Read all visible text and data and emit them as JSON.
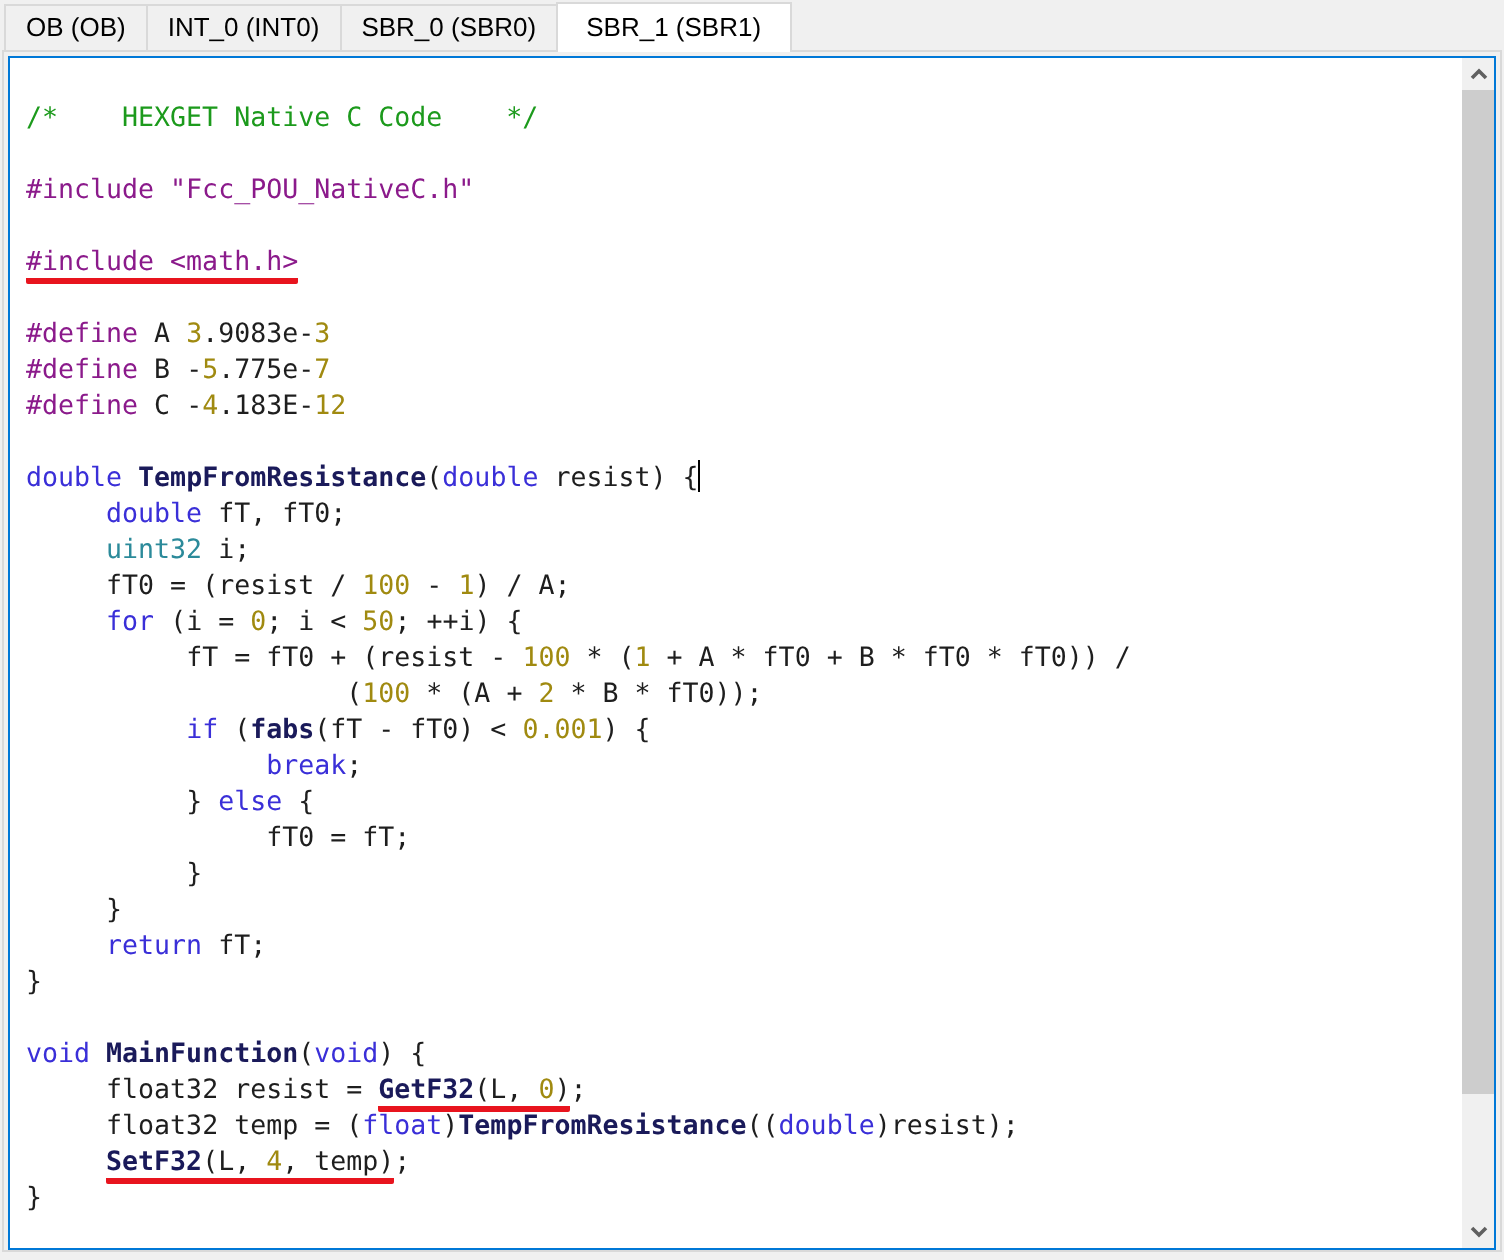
{
  "tabs": [
    {
      "label": "OB (OB)",
      "selected": false
    },
    {
      "label": "INT_0 (INT0)",
      "selected": false
    },
    {
      "label": "SBR_0 (SBR0)",
      "selected": false
    },
    {
      "label": "SBR_1 (SBR1)",
      "selected": true
    }
  ],
  "editor": {
    "lines": [
      {
        "kind": "blank"
      },
      {
        "kind": "code",
        "groups": [
          {
            "underlined": false,
            "tokens": [
              {
                "kind": "comment",
                "text": "/*    HEXGET Native C Code    */"
              }
            ]
          }
        ]
      },
      {
        "kind": "blank"
      },
      {
        "kind": "code",
        "groups": [
          {
            "underlined": false,
            "tokens": [
              {
                "kind": "directive",
                "text": "#include \"Fcc_POU_NativeC.h\""
              }
            ]
          }
        ]
      },
      {
        "kind": "blank"
      },
      {
        "kind": "code",
        "groups": [
          {
            "underlined": true,
            "tokens": [
              {
                "kind": "directive",
                "text": "#include <math.h>"
              }
            ]
          }
        ]
      },
      {
        "kind": "blank"
      },
      {
        "kind": "code",
        "groups": [
          {
            "underlined": false,
            "tokens": [
              {
                "kind": "directive",
                "text": "#define"
              },
              {
                "kind": "plain",
                "text": " A "
              },
              {
                "kind": "number",
                "text": "3"
              },
              {
                "kind": "plain",
                "text": ".9083e-"
              },
              {
                "kind": "number",
                "text": "3"
              }
            ]
          }
        ]
      },
      {
        "kind": "code",
        "groups": [
          {
            "underlined": false,
            "tokens": [
              {
                "kind": "directive",
                "text": "#define"
              },
              {
                "kind": "plain",
                "text": " B -"
              },
              {
                "kind": "number",
                "text": "5"
              },
              {
                "kind": "plain",
                "text": ".775e-"
              },
              {
                "kind": "number",
                "text": "7"
              }
            ]
          }
        ]
      },
      {
        "kind": "code",
        "groups": [
          {
            "underlined": false,
            "tokens": [
              {
                "kind": "directive",
                "text": "#define"
              },
              {
                "kind": "plain",
                "text": " C -"
              },
              {
                "kind": "number",
                "text": "4"
              },
              {
                "kind": "plain",
                "text": ".183E-"
              },
              {
                "kind": "number",
                "text": "12"
              }
            ]
          }
        ]
      },
      {
        "kind": "blank"
      },
      {
        "kind": "code",
        "groups": [
          {
            "underlined": false,
            "tokens": [
              {
                "kind": "keyword",
                "text": "double "
              },
              {
                "kind": "function",
                "text": "TempFromResistance"
              },
              {
                "kind": "plain",
                "text": "("
              },
              {
                "kind": "keyword",
                "text": "double"
              },
              {
                "kind": "plain",
                "text": " resist) {"
              },
              {
                "kind": "cursor"
              }
            ]
          }
        ]
      },
      {
        "kind": "code",
        "groups": [
          {
            "underlined": false,
            "tokens": [
              {
                "kind": "keyword",
                "text": "     double"
              },
              {
                "kind": "plain",
                "text": " fT, fT0;"
              }
            ]
          }
        ]
      },
      {
        "kind": "code",
        "groups": [
          {
            "underlined": false,
            "tokens": [
              {
                "kind": "type",
                "text": "     uint32"
              },
              {
                "kind": "plain",
                "text": " i;"
              }
            ]
          }
        ]
      },
      {
        "kind": "code",
        "groups": [
          {
            "underlined": false,
            "tokens": [
              {
                "kind": "plain",
                "text": "     fT0 = (resist / "
              },
              {
                "kind": "number",
                "text": "100"
              },
              {
                "kind": "plain",
                "text": " - "
              },
              {
                "kind": "number",
                "text": "1"
              },
              {
                "kind": "plain",
                "text": ") / A;"
              }
            ]
          }
        ]
      },
      {
        "kind": "code",
        "groups": [
          {
            "underlined": false,
            "tokens": [
              {
                "kind": "keyword",
                "text": "     for"
              },
              {
                "kind": "plain",
                "text": " (i = "
              },
              {
                "kind": "number",
                "text": "0"
              },
              {
                "kind": "plain",
                "text": "; i < "
              },
              {
                "kind": "number",
                "text": "50"
              },
              {
                "kind": "plain",
                "text": "; ++i) {"
              }
            ]
          }
        ]
      },
      {
        "kind": "code",
        "groups": [
          {
            "underlined": false,
            "tokens": [
              {
                "kind": "plain",
                "text": "          fT = fT0 + (resist - "
              },
              {
                "kind": "number",
                "text": "100"
              },
              {
                "kind": "plain",
                "text": " * ("
              },
              {
                "kind": "number",
                "text": "1"
              },
              {
                "kind": "plain",
                "text": " + A * fT0 + B * fT0 * fT0)) /"
              }
            ]
          }
        ]
      },
      {
        "kind": "code",
        "groups": [
          {
            "underlined": false,
            "tokens": [
              {
                "kind": "plain",
                "text": "                    ("
              },
              {
                "kind": "number",
                "text": "100"
              },
              {
                "kind": "plain",
                "text": " * (A + "
              },
              {
                "kind": "number",
                "text": "2"
              },
              {
                "kind": "plain",
                "text": " * B * fT0));"
              }
            ]
          }
        ]
      },
      {
        "kind": "code",
        "groups": [
          {
            "underlined": false,
            "tokens": [
              {
                "kind": "keyword",
                "text": "          if"
              },
              {
                "kind": "plain",
                "text": " ("
              },
              {
                "kind": "function",
                "text": "fabs"
              },
              {
                "kind": "plain",
                "text": "(fT - fT0) < "
              },
              {
                "kind": "number",
                "text": "0.001"
              },
              {
                "kind": "plain",
                "text": ") {"
              }
            ]
          }
        ]
      },
      {
        "kind": "code",
        "groups": [
          {
            "underlined": false,
            "tokens": [
              {
                "kind": "keyword",
                "text": "               break"
              },
              {
                "kind": "plain",
                "text": ";"
              }
            ]
          }
        ]
      },
      {
        "kind": "code",
        "groups": [
          {
            "underlined": false,
            "tokens": [
              {
                "kind": "plain",
                "text": "          } "
              },
              {
                "kind": "keyword",
                "text": "else"
              },
              {
                "kind": "plain",
                "text": " {"
              }
            ]
          }
        ]
      },
      {
        "kind": "code",
        "groups": [
          {
            "underlined": false,
            "tokens": [
              {
                "kind": "plain",
                "text": "               fT0 = fT;"
              }
            ]
          }
        ]
      },
      {
        "kind": "code",
        "groups": [
          {
            "underlined": false,
            "tokens": [
              {
                "kind": "plain",
                "text": "          }"
              }
            ]
          }
        ]
      },
      {
        "kind": "code",
        "groups": [
          {
            "underlined": false,
            "tokens": [
              {
                "kind": "plain",
                "text": "     }"
              }
            ]
          }
        ]
      },
      {
        "kind": "code",
        "groups": [
          {
            "underlined": false,
            "tokens": [
              {
                "kind": "keyword",
                "text": "     return"
              },
              {
                "kind": "plain",
                "text": " fT;"
              }
            ]
          }
        ]
      },
      {
        "kind": "code",
        "groups": [
          {
            "underlined": false,
            "tokens": [
              {
                "kind": "plain",
                "text": "}"
              }
            ]
          }
        ]
      },
      {
        "kind": "blank"
      },
      {
        "kind": "code",
        "groups": [
          {
            "underlined": false,
            "tokens": [
              {
                "kind": "keyword",
                "text": "void "
              },
              {
                "kind": "function",
                "text": "MainFunction"
              },
              {
                "kind": "plain",
                "text": "("
              },
              {
                "kind": "keyword",
                "text": "void"
              },
              {
                "kind": "plain",
                "text": ") {"
              }
            ]
          }
        ]
      },
      {
        "kind": "code",
        "groups": [
          {
            "underlined": false,
            "tokens": [
              {
                "kind": "plain",
                "text": "     float32 resist = "
              }
            ]
          },
          {
            "underlined": true,
            "tokens": [
              {
                "kind": "function",
                "text": "GetF32"
              },
              {
                "kind": "plain",
                "text": "(L, "
              },
              {
                "kind": "number",
                "text": "0"
              },
              {
                "kind": "plain",
                "text": ")"
              }
            ]
          },
          {
            "underlined": false,
            "tokens": [
              {
                "kind": "plain",
                "text": ";"
              }
            ]
          }
        ]
      },
      {
        "kind": "code",
        "groups": [
          {
            "underlined": false,
            "tokens": [
              {
                "kind": "plain",
                "text": "     float32 temp = ("
              },
              {
                "kind": "keyword",
                "text": "float"
              },
              {
                "kind": "plain",
                "text": ")"
              },
              {
                "kind": "function",
                "text": "TempFromResistance"
              },
              {
                "kind": "plain",
                "text": "(("
              },
              {
                "kind": "keyword",
                "text": "double"
              },
              {
                "kind": "plain",
                "text": ")resist);"
              }
            ]
          }
        ]
      },
      {
        "kind": "code",
        "groups": [
          {
            "underlined": true,
            "tokens": [
              {
                "kind": "function",
                "text": "     SetF32"
              },
              {
                "kind": "plain",
                "text": "(L, "
              },
              {
                "kind": "number",
                "text": "4"
              },
              {
                "kind": "plain",
                "text": ", temp)"
              }
            ]
          },
          {
            "underlined": false,
            "tokens": [
              {
                "kind": "plain",
                "text": ";"
              }
            ]
          }
        ]
      },
      {
        "kind": "code",
        "groups": [
          {
            "underlined": false,
            "tokens": [
              {
                "kind": "plain",
                "text": "}"
              }
            ]
          }
        ]
      }
    ]
  }
}
